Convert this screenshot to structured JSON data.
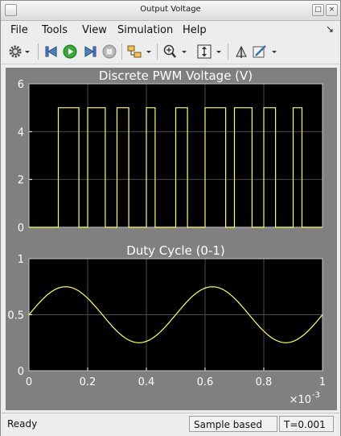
{
  "window": {
    "title": "Output Voltage"
  },
  "menu": {
    "items": [
      "File",
      "Tools",
      "View",
      "Simulation",
      "Help"
    ]
  },
  "toolbar": {
    "icons": [
      "gear-icon",
      "step-back-icon",
      "run-icon",
      "step-forward-icon",
      "stop-icon",
      "highlight-block-icon",
      "zoom-icon",
      "scale-axes-icon",
      "float-window-icon",
      "edit-style-icon"
    ]
  },
  "colors": {
    "plot_bg": "#000000",
    "frame_bg": "#808080",
    "trace": "#ffff55",
    "grid": "#4b4b4b",
    "text": "#ffffff"
  },
  "chart_data": [
    {
      "type": "line",
      "title": "Discrete PWM Voltage (V)",
      "xlim": [
        0,
        0.001
      ],
      "ylim": [
        0,
        6
      ],
      "yticks": [
        "0",
        "2",
        "4",
        "6"
      ],
      "grid": true,
      "series": [
        {
          "x": [
            0,
            0.0001,
            0.0001,
            0.00017,
            0.00017,
            0.0002,
            0.0002,
            0.00026,
            0.00026,
            0.0003,
            0.0003,
            0.00034,
            0.00034,
            0.0004,
            0.0004,
            0.00043,
            0.00043,
            0.0005,
            0.0005,
            0.00054,
            0.00054,
            0.0006,
            0.0006,
            0.00067,
            0.00067,
            0.0007,
            0.0007,
            0.00076,
            0.00076,
            0.0008,
            0.0008,
            0.00084,
            0.00084,
            0.0009,
            0.0009,
            0.00093,
            0.00093,
            0.001
          ],
          "y": [
            0,
            0,
            5,
            5,
            0,
            0,
            5,
            5,
            0,
            0,
            5,
            5,
            0,
            0,
            5,
            5,
            0,
            0,
            5,
            5,
            0,
            0,
            5,
            5,
            0,
            0,
            5,
            5,
            0,
            0,
            5,
            5,
            0,
            0,
            5,
            5,
            0,
            0
          ]
        }
      ]
    },
    {
      "type": "line",
      "title": "Duty Cycle (0-1)",
      "xlim": [
        0,
        0.001
      ],
      "ylim": [
        0,
        1
      ],
      "yticks": [
        "0",
        "0.5",
        "1"
      ],
      "xticks": [
        "0",
        "0.2",
        "0.4",
        "0.6",
        "0.8",
        "1"
      ],
      "x_multiplier": "×10",
      "x_exponent": "-3",
      "grid": true,
      "series": [
        {
          "x": [
            0,
            6.25e-05,
            0.000125,
            0.0001875,
            0.00025,
            0.0003125,
            0.000375,
            0.0004375,
            0.0005,
            0.0005625,
            0.000625,
            0.0006875,
            0.00075,
            0.0008125,
            0.000875,
            0.0009375,
            0.001
          ],
          "y": [
            0.5,
            0.677,
            0.75,
            0.677,
            0.5,
            0.323,
            0.25,
            0.323,
            0.5,
            0.677,
            0.75,
            0.677,
            0.5,
            0.323,
            0.25,
            0.323,
            0.5
          ]
        }
      ]
    }
  ],
  "status": {
    "text": "Ready",
    "sample_mode": "Sample based",
    "time": "T=0.001"
  }
}
